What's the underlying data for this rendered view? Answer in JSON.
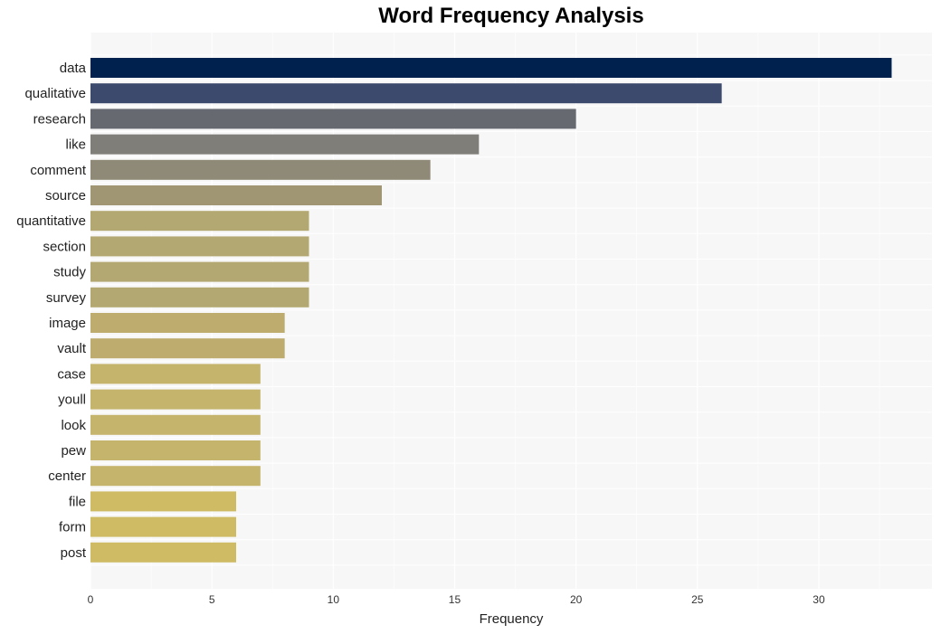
{
  "chart_data": {
    "type": "bar",
    "orientation": "horizontal",
    "title": "Word Frequency Analysis",
    "xlabel": "Frequency",
    "ylabel": "",
    "xlim": [
      0,
      34.66
    ],
    "xticks": [
      0,
      5,
      10,
      15,
      20,
      25,
      30
    ],
    "grid": true,
    "legend": "none",
    "categories": [
      "data",
      "qualitative",
      "research",
      "like",
      "comment",
      "source",
      "quantitative",
      "section",
      "study",
      "survey",
      "image",
      "vault",
      "case",
      "youll",
      "look",
      "pew",
      "center",
      "file",
      "form",
      "post"
    ],
    "values": [
      33,
      26,
      20,
      16,
      14,
      12,
      9,
      9,
      9,
      9,
      8,
      8,
      7,
      7,
      7,
      7,
      7,
      6,
      6,
      6
    ],
    "colors": [
      "#00204e",
      "#3c4a6e",
      "#676970",
      "#807e78",
      "#8f8a77",
      "#a09673",
      "#b4a872",
      "#b4a872",
      "#b4a872",
      "#b4a872",
      "#bdac6e",
      "#bdac6e",
      "#c5b46c",
      "#c5b46c",
      "#c5b46c",
      "#c5b46c",
      "#c5b46c",
      "#cebb63",
      "#cebb63",
      "#cebb63"
    ]
  },
  "style": {
    "plot_background": "#f7f7f8",
    "grid_color": "#ffffff"
  }
}
